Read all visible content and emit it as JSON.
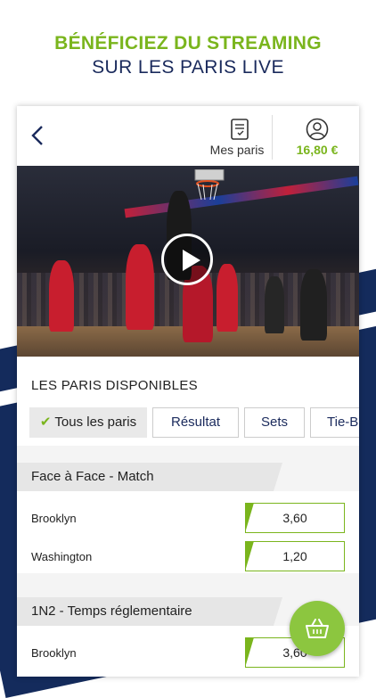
{
  "promo": {
    "line1": "BÉNÉFICIEZ DU STREAMING",
    "line2": "SUR LES PARIS LIVE"
  },
  "header": {
    "back_icon": "chevron-left-icon",
    "mes_paris_icon": "bet-slip-icon",
    "mes_paris_label": "Mes paris",
    "account_icon": "user-circle-icon",
    "balance": "16,80 €"
  },
  "video": {
    "play_icon": "play-icon"
  },
  "paris": {
    "title": "LES PARIS DISPONIBLES",
    "tabs": [
      {
        "label": "Tous les paris",
        "active": true
      },
      {
        "label": "Résultat",
        "active": false
      },
      {
        "label": "Sets",
        "active": false
      },
      {
        "label": "Tie-B",
        "active": false
      }
    ]
  },
  "markets": [
    {
      "title": "Face à Face - Match",
      "rows": [
        {
          "team": "Brooklyn",
          "odd": "3,60"
        },
        {
          "team": "Washington",
          "odd": "1,20"
        }
      ]
    },
    {
      "title": "1N2 - Temps réglementaire",
      "rows": [
        {
          "team": "Brooklyn",
          "odd": "3,60"
        }
      ]
    }
  ],
  "cart": {
    "icon": "basket-icon"
  },
  "colors": {
    "accent": "#7ab51d",
    "navy": "#1a2a5c",
    "cart": "#8cc63f"
  }
}
